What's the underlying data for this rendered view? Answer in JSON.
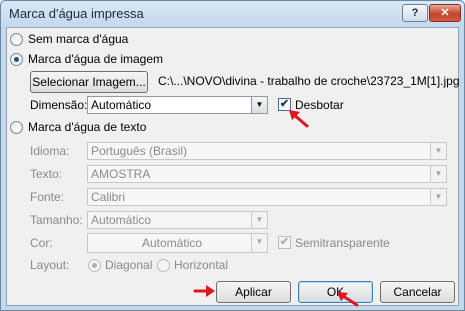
{
  "window": {
    "title": "Marca d'água impressa",
    "help_label": "?",
    "close_label": "✕"
  },
  "options": {
    "no_watermark": "Sem marca d'água",
    "image_watermark": "Marca d'água de imagem",
    "text_watermark": "Marca d'água de texto"
  },
  "image": {
    "select_button": "Selecionar Imagem...",
    "path": "C:\\...\\NOVO\\divina - trabalho de croche\\23723_1M[1].jpg",
    "scale_label": "Dimensão:",
    "scale_value": "Automático",
    "washout_label": "Desbotar",
    "washout_checked": "✔"
  },
  "text": {
    "language_label": "Idioma:",
    "language_value": "Português (Brasil)",
    "text_label": "Texto:",
    "text_value": "AMOSTRA",
    "font_label": "Fonte:",
    "font_value": "Calibri",
    "size_label": "Tamanho:",
    "size_value": "Automático",
    "color_label": "Cor:",
    "color_value": "Automático",
    "semitransparent_label": "Semitransparente",
    "semitransparent_checked": "✔",
    "layout_label": "Layout:",
    "layout_diagonal": "Diagonal",
    "layout_horizontal": "Horizontal"
  },
  "buttons": {
    "apply": "Aplicar",
    "ok": "OK",
    "cancel": "Cancelar"
  },
  "colors": {
    "annotation_red": "#e0141e",
    "accent": "#3c7fb1"
  }
}
